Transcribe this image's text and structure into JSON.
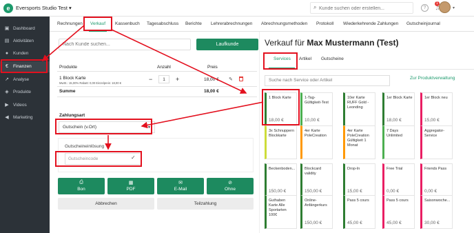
{
  "topbar": {
    "logo_letter": "e",
    "studio_name": "Eversports Studio Test ▾",
    "search_placeholder": "Kunde suchen oder erstellen...",
    "help_glyph": "?",
    "notification_count": "1"
  },
  "sidebar": {
    "items": [
      {
        "label": "Dashboard",
        "icon": "dashboard-icon",
        "glyph": "▣"
      },
      {
        "label": "Aktivitäten",
        "icon": "calendar-icon",
        "glyph": "▤"
      },
      {
        "label": "Kunden",
        "icon": "person-icon",
        "glyph": "●"
      },
      {
        "label": "Finanzen",
        "icon": "euro-icon",
        "glyph": "€"
      },
      {
        "label": "Analyse",
        "icon": "chart-icon",
        "glyph": "↗"
      },
      {
        "label": "Produkte",
        "icon": "box-icon",
        "glyph": "◈"
      },
      {
        "label": "Videos",
        "icon": "play-icon",
        "glyph": "▶"
      },
      {
        "label": "Marketing",
        "icon": "megaphone-icon",
        "glyph": "◀"
      }
    ]
  },
  "tabs": [
    "Rechnungen",
    "Verkauf",
    "Kassenbuch",
    "Tagesabschluss",
    "Berichte",
    "Lehrerabrechnungen",
    "Abrechnungsmethoden",
    "Protokoll",
    "Wiederkehrende Zahlungen",
    "Gutscheinjournal"
  ],
  "left": {
    "customer_placeholder": "Nach Kunde suchen...",
    "laufkunde_label": "Laufkunde",
    "col_produkte": "Produkte",
    "col_anzahl": "Anzahl",
    "col_preis": "Preis",
    "product_name": "1 Block Karte",
    "product_sub": "MwSt.: 15,00% Rabatt: 0,00 Einzelpreis: 18,00 €",
    "quantity": "1",
    "minus": "−",
    "plus": "+",
    "product_price": "18,00 €",
    "sum_label": "Summe",
    "sum_value": "18,00 €",
    "payment_label": "Zahlungsart",
    "payment_value": "Gutschein (v.Ort)",
    "voucher_label": "Gutscheineinlösung",
    "voucher_placeholder": "Gutscheincode",
    "actions": [
      {
        "label": "Bon",
        "glyph": "⎙"
      },
      {
        "label": "PDF",
        "glyph": "▦"
      },
      {
        "label": "E-Mail",
        "glyph": "✉"
      },
      {
        "label": "Ohne",
        "glyph": "⊘"
      }
    ],
    "cancel_label": "Abbrechen",
    "partial_label": "Teilzahlung"
  },
  "right": {
    "title_prefix": "Verkauf für ",
    "customer_name": "Max Mustermann (Test)",
    "subtabs": [
      "Services",
      "Artikel",
      "Gutscheine"
    ],
    "service_search_placeholder": "Suche nach Service oder Artikel",
    "manage_link": "Zur Produktverwaltung",
    "cards": [
      {
        "title": "1 Block Karte",
        "price": "18,00 €",
        "color": "#2e7d32"
      },
      {
        "title": "1-Tag-Gültigkeit-Test",
        "price": "10,00 €",
        "color": "#4caf50"
      },
      {
        "title": "10er Karte RUFF Gold - Leonding",
        "price": "",
        "color": "#2e7d32"
      },
      {
        "title": "1er Block Karte",
        "price": "18,00 €",
        "color": "#2e7d32"
      },
      {
        "title": "1er Block neu",
        "price": "15,00 €",
        "color": "#e91e63"
      },
      {
        "title": "3x Schnuppern Blockkarte",
        "price": "",
        "color": "#cddc39"
      },
      {
        "title": "4er Karte PoleCreation",
        "price": "",
        "color": "#ff9800"
      },
      {
        "title": "4er Karte PoleCreation Gültigkeit 1 Monat",
        "price": "",
        "color": "#ff9800"
      },
      {
        "title": "7 Days Unlimited",
        "price": "",
        "color": "#4caf50"
      },
      {
        "title": "Aggregator-Service",
        "price": "",
        "color": "#e91e63"
      },
      {
        "title": "Beckenboden...",
        "price": "150,00 €",
        "color": "#2e7d32"
      },
      {
        "title": "Blockcard validity",
        "price": "150,00 €",
        "color": "#2e7d32"
      },
      {
        "title": "Drop-In",
        "price": "15,00 €",
        "color": "#2e7d32"
      },
      {
        "title": "Free Trial",
        "price": "0,00 €",
        "color": "#e91e63"
      },
      {
        "title": "Friends Pass",
        "price": "0,00 €",
        "color": "#e91e63"
      },
      {
        "title": "Guthaben Karte Alle Sportarten 100€",
        "price": "",
        "color": "#2e7d32"
      },
      {
        "title": "Online-Anfängerkurs",
        "price": "150,00 €",
        "color": "#2e7d32"
      },
      {
        "title": "Pass 5 cours",
        "price": "45,00 €",
        "color": "#2e7d32"
      },
      {
        "title": "Pass 5 cours",
        "price": "45,00 €",
        "color": "#e91e63"
      },
      {
        "title": "Saisonwoche...",
        "price": "30,00 €",
        "color": "#e91e63"
      }
    ]
  }
}
